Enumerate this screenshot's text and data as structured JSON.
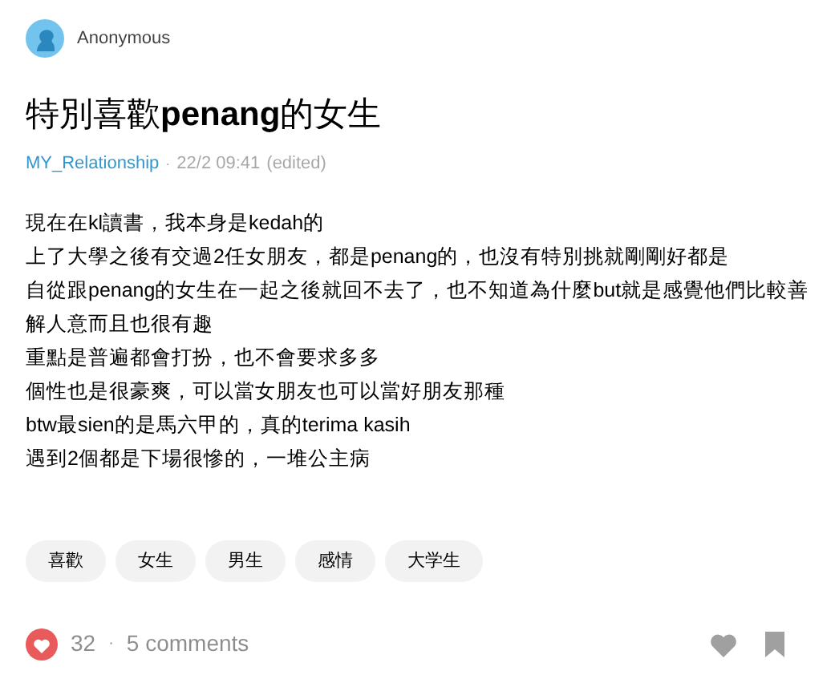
{
  "author": {
    "name": "Anonymous"
  },
  "title": "特別喜歡**penang**的女生",
  "meta": {
    "board": "MY_Relationship",
    "separator": "·",
    "time": "22/2 09:41",
    "edited": "(edited)"
  },
  "body": [
    "現在在kl讀書，我本身是kedah的",
    "上了大學之後有交過2任女朋友，都是penang的，也沒有特別挑就剛剛好都是",
    "自從跟penang的女生在一起之後就回不去了，也不知道為什麼but就是感覺他們比較善",
    "解人意而且也很有趣",
    "重點是普遍都會打扮，也不會要求多多",
    "個性也是很豪爽，可以當女朋友也可以當好朋友那種",
    "btw最sien的是馬六甲的，真的terima kasih",
    "遇到2個都是下場很慘的，一堆公主病"
  ],
  "tags": [
    "喜歡",
    "女生",
    "男生",
    "感情",
    "大学生"
  ],
  "footer": {
    "likes": "32",
    "separator": "·",
    "comments": "5 comments",
    "liked": false,
    "saved": false
  }
}
